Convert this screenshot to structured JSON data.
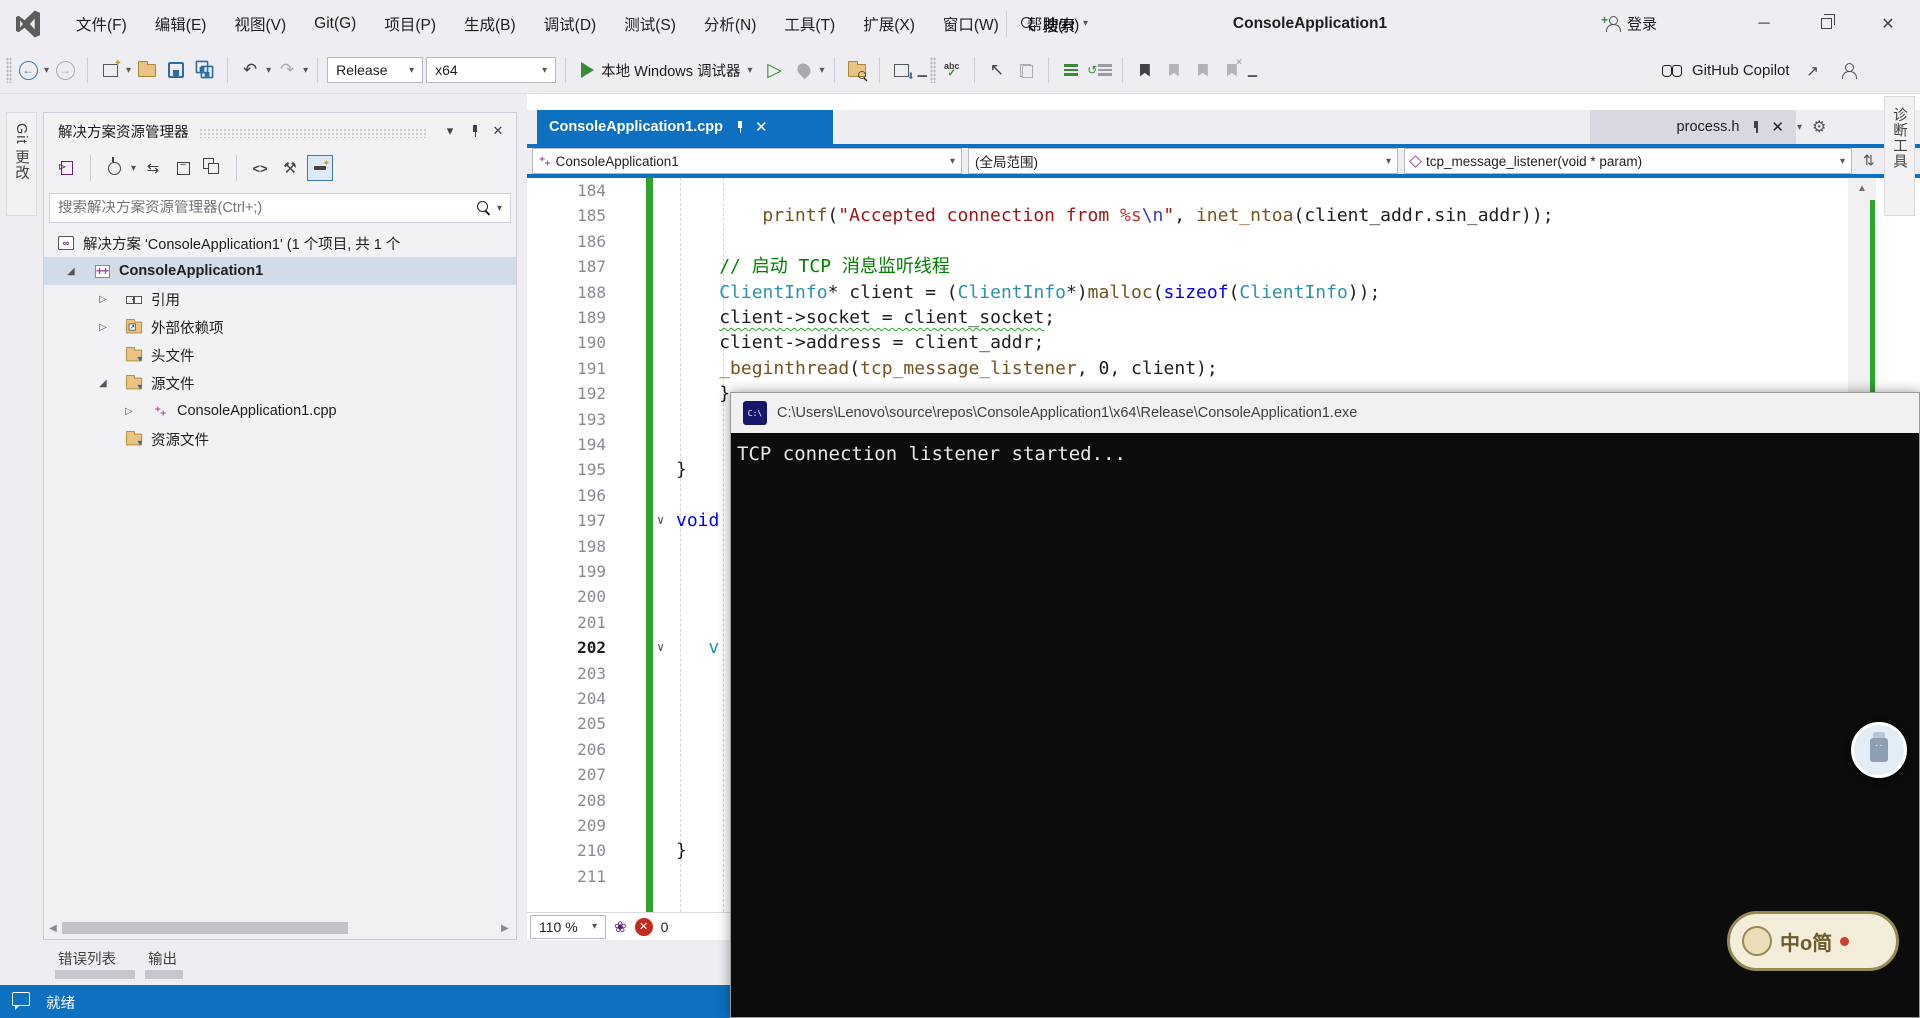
{
  "window": {
    "title": "ConsoleApplication1",
    "signin": "登录",
    "search": "搜索",
    "controls": {
      "minimize": "─",
      "restore": "restore",
      "close": "✕"
    }
  },
  "menus": [
    "文件(F)",
    "编辑(E)",
    "视图(V)",
    "Git(G)",
    "项目(P)",
    "生成(B)",
    "调试(D)",
    "测试(S)",
    "分析(N)",
    "工具(T)",
    "扩展(X)",
    "窗口(W)",
    "帮助(H)"
  ],
  "toolbar": {
    "configuration": "Release",
    "platform": "x64",
    "debug_target": "本地 Windows 调试器",
    "copilot": "GitHub Copilot"
  },
  "side_tabs": {
    "left": "Git 更改",
    "right": "诊断工具"
  },
  "solution_explorer": {
    "title": "解决方案资源管理器",
    "search_placeholder": "搜索解决方案资源管理器(Ctrl+;)",
    "tree": [
      {
        "label": "解决方案 'ConsoleApplication1' (1 个项目, 共 1 个",
        "icon": "solution",
        "level": 0,
        "expander": "none"
      },
      {
        "label": "ConsoleApplication1",
        "icon": "project",
        "level": 1,
        "expander": "open",
        "bold": true,
        "selected": true
      },
      {
        "label": "引用",
        "icon": "refs",
        "level": 2,
        "expander": "closed"
      },
      {
        "label": "外部依赖项",
        "icon": "extdep",
        "level": 2,
        "expander": "closed"
      },
      {
        "label": "头文件",
        "icon": "folder",
        "level": 2,
        "expander": "none"
      },
      {
        "label": "源文件",
        "icon": "folder",
        "level": 2,
        "expander": "open"
      },
      {
        "label": "ConsoleApplication1.cpp",
        "icon": "cpp",
        "level": 3,
        "expander": "closed"
      },
      {
        "label": "资源文件",
        "icon": "folder",
        "level": 2,
        "expander": "none"
      }
    ]
  },
  "editor": {
    "active_tab": "ConsoleApplication1.cpp",
    "preview_tab": "process.h",
    "nav_project": "ConsoleApplication1",
    "nav_scope": "(全局范围)",
    "nav_member": "tcp_message_listener(void * param)",
    "zoom_level": "110 %",
    "error_count": "0",
    "first_line": 184,
    "code": [
      {
        "n": 184,
        "segs": []
      },
      {
        "n": 185,
        "indent": 8,
        "segs": [
          [
            "fn",
            "printf"
          ],
          [
            "pl",
            "("
          ],
          [
            "str",
            "\"Accepted connection from "
          ],
          [
            "fmt",
            "%s"
          ],
          [
            "esc",
            "\\n"
          ],
          [
            "str",
            "\""
          ],
          [
            "pl",
            ", "
          ],
          [
            "fn",
            "inet_ntoa"
          ],
          [
            "pl",
            "(client_addr.sin_addr));"
          ]
        ]
      },
      {
        "n": 186,
        "segs": []
      },
      {
        "n": 187,
        "indent": 4,
        "segs": [
          [
            "com",
            "// 启动 TCP 消息监听线程"
          ]
        ]
      },
      {
        "n": 188,
        "indent": 4,
        "segs": [
          [
            "type",
            "ClientInfo"
          ],
          [
            "pl",
            "* client = ("
          ],
          [
            "type",
            "ClientInfo"
          ],
          [
            "pl",
            "*)"
          ],
          [
            "fn",
            "malloc"
          ],
          [
            "pl",
            "("
          ],
          [
            "kw",
            "sizeof"
          ],
          [
            "pl",
            "("
          ],
          [
            "type",
            "ClientInfo"
          ],
          [
            "pl",
            "));"
          ]
        ]
      },
      {
        "n": 189,
        "indent": 4,
        "segs": [
          [
            "sq",
            "client->socket = client_socket"
          ],
          [
            "pl",
            ";"
          ]
        ]
      },
      {
        "n": 190,
        "indent": 4,
        "segs": [
          [
            "pl",
            "client->address = client_addr;"
          ]
        ]
      },
      {
        "n": 191,
        "indent": 4,
        "segs": [
          [
            "fn",
            "_beginthread"
          ],
          [
            "pl",
            "("
          ],
          [
            "fn",
            "tcp_message_listener"
          ],
          [
            "pl",
            ", "
          ],
          [
            "num",
            "0"
          ],
          [
            "pl",
            ", client);"
          ]
        ]
      },
      {
        "n": 192,
        "indent": 4,
        "segs": [
          [
            "pl",
            "}"
          ]
        ]
      },
      {
        "n": 193,
        "segs": []
      },
      {
        "n": 194,
        "segs": []
      },
      {
        "n": 195,
        "indent": 0,
        "segs": [
          [
            "pl",
            "}"
          ]
        ]
      },
      {
        "n": 196,
        "segs": []
      },
      {
        "n": 197,
        "indent": 0,
        "fold": true,
        "segs": [
          [
            "kw",
            "void"
          ]
        ]
      },
      {
        "n": 198,
        "segs": []
      },
      {
        "n": 199,
        "segs": []
      },
      {
        "n": 200,
        "segs": []
      },
      {
        "n": 201,
        "segs": []
      },
      {
        "n": 202,
        "indent": 3,
        "fold": true,
        "current": true,
        "segs": [
          [
            "type",
            "v"
          ]
        ]
      },
      {
        "n": 203,
        "segs": []
      },
      {
        "n": 204,
        "segs": []
      },
      {
        "n": 205,
        "segs": []
      },
      {
        "n": 206,
        "segs": []
      },
      {
        "n": 207,
        "segs": []
      },
      {
        "n": 208,
        "segs": []
      },
      {
        "n": 209,
        "segs": []
      },
      {
        "n": 210,
        "indent": 0,
        "segs": [
          [
            "pl",
            "}"
          ]
        ]
      },
      {
        "n": 211,
        "segs": []
      }
    ]
  },
  "console": {
    "title_path": "C:\\Users\\Lenovo\\source\\repos\\ConsoleApplication1\\x64\\Release\\ConsoleApplication1.exe",
    "icon_label": "C:\\",
    "output_line": "TCP connection listener started..."
  },
  "panels": {
    "bottom_tabs": [
      "错误列表",
      "输出"
    ]
  },
  "statusbar": {
    "text": "就绪"
  },
  "watermark": {
    "text": "中o简"
  },
  "colors": {
    "accent": "#0E70C0",
    "status_bg": "#0E70C0",
    "console_bg": "#0C0C0C",
    "change_bar": "#2EA32E",
    "selection_bg": "#D2DBE8",
    "comment": "#008000",
    "keyword": "#0000FF",
    "type": "#2B91AF",
    "string": "#A31515",
    "function": "#74531F",
    "escape": "#3B3BC8",
    "format": "#C03434"
  }
}
